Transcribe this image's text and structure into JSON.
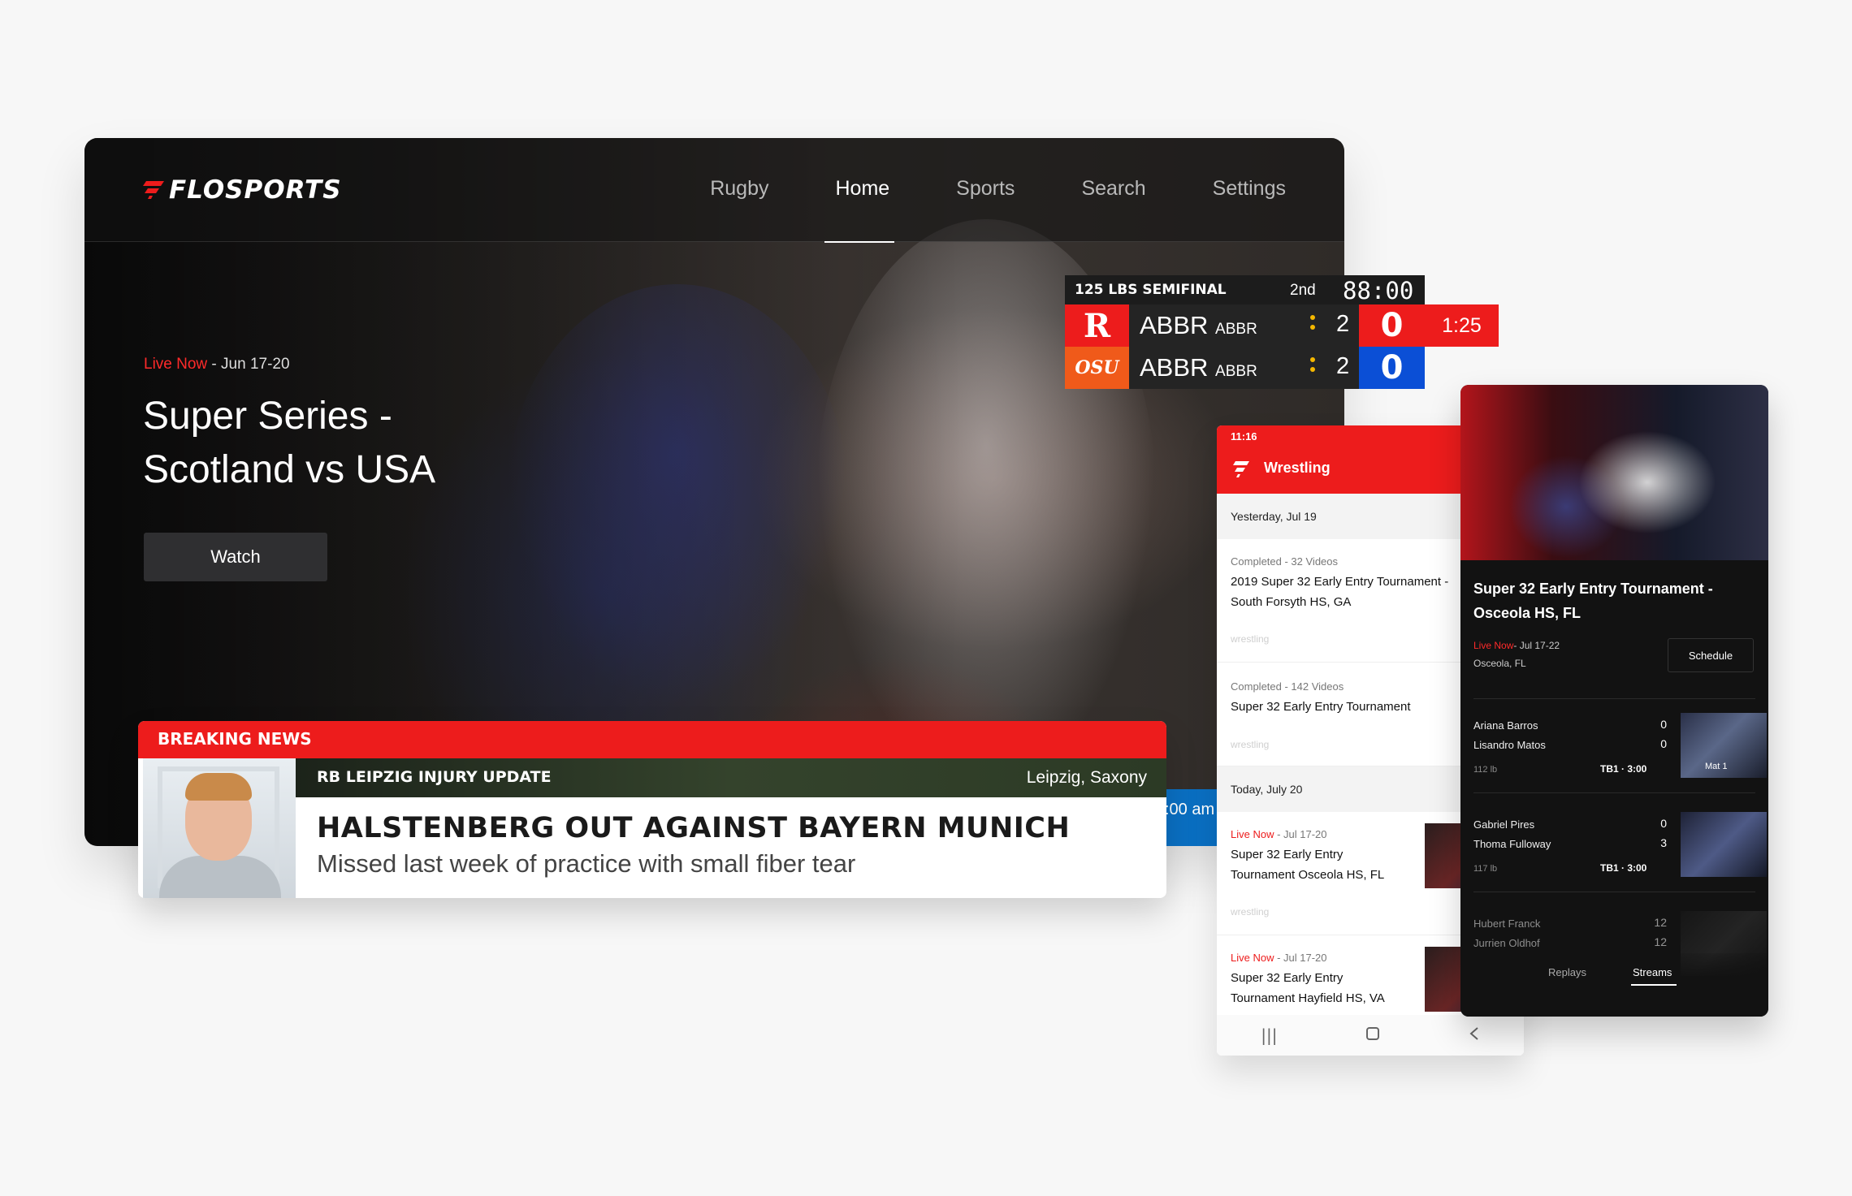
{
  "tv": {
    "logo": "FLOSPORTS",
    "nav": [
      "Rugby",
      "Home",
      "Sports",
      "Search",
      "Settings"
    ],
    "active_nav": "Home",
    "hero": {
      "live": "Live Now",
      "date": " - Jun 17-20",
      "title": "Super Series - Scotland vs USA",
      "watch": "Watch"
    },
    "partial_time": ":00 am"
  },
  "news": {
    "banner": "BREAKING NEWS",
    "sub": "RB LEIPZIG INJURY UPDATE",
    "location": "Leipzig, Saxony",
    "headline": "HALSTENBERG OUT AGAINST BAYERN MUNICH",
    "deck": "Missed last week of practice with small fiber tear"
  },
  "scoreboard": {
    "event": "125 LBS SEMIFINAL",
    "period": "2nd",
    "clock": "88:00",
    "time": "1:25",
    "colors": {
      "red": "#ed1c1c",
      "blue": "#0b4fd6",
      "osu": "#f05a1a",
      "rutgers": "#cc0000"
    },
    "rows": [
      {
        "logo": "R",
        "abbr": "ABBR",
        "abbr_small": "ABBR",
        "sub": "2",
        "points": "0"
      },
      {
        "logo": "OSU",
        "abbr": "ABBR",
        "abbr_small": "ABBR",
        "sub": "2",
        "points": "0"
      }
    ]
  },
  "phone": {
    "time": "11:16",
    "title": "Wrestling",
    "day1": "Yesterday, Jul 19",
    "day2": "Today, July 20",
    "items": [
      {
        "status": "Completed",
        "extra": " - 32 Videos",
        "name1": "2019 Super 32 Early Entry Tournament -",
        "name2": "South Forsyth HS, GA",
        "tag": "wrestling"
      },
      {
        "status": "Completed",
        "extra": " - 142 Videos",
        "name1": "Super 32 Early Entry Tournament",
        "name2": "",
        "tag": "wrestling"
      },
      {
        "status": "Live Now",
        "extra": " - Jul 17-20",
        "name1": "Super 32 Early Entry",
        "name2": "Tournament Osceola HS, FL",
        "tag": "wrestling"
      },
      {
        "status": "Live Now",
        "extra": " - Jul 17-20",
        "name1": "Super 32 Early Entry",
        "name2": "Tournament Hayfield HS, VA",
        "tag": ""
      }
    ],
    "nav_icons": [
      "recent-apps-icon",
      "home-icon",
      "back-icon"
    ]
  },
  "dark": {
    "title": "Super 32 Early Entry Tournament - Osceola HS, FL",
    "live": "Live Now",
    "date": "- Jul 17-22",
    "location": "Osceola, FL",
    "schedule": "Schedule",
    "matches": [
      {
        "a": "Ariana Barros",
        "sa": "0",
        "b": "Lisandro Matos",
        "sb": "0",
        "weight": "112 lb",
        "tb": "TB1 · 3:00",
        "thumb": "Mat 1"
      },
      {
        "a": "Gabriel Pires",
        "sa": "0",
        "b": "Thoma Fulloway",
        "sb": "3",
        "weight": "117 lb",
        "tb": "TB1 · 3:00",
        "thumb": ""
      },
      {
        "a": "Hubert Franck",
        "sa": "12",
        "b": "Jurrien Oldhof",
        "sb": "12",
        "weight": "",
        "tb": "",
        "thumb": ""
      }
    ],
    "tabs": [
      "Replays",
      "Streams"
    ],
    "active_tab": "Streams"
  }
}
